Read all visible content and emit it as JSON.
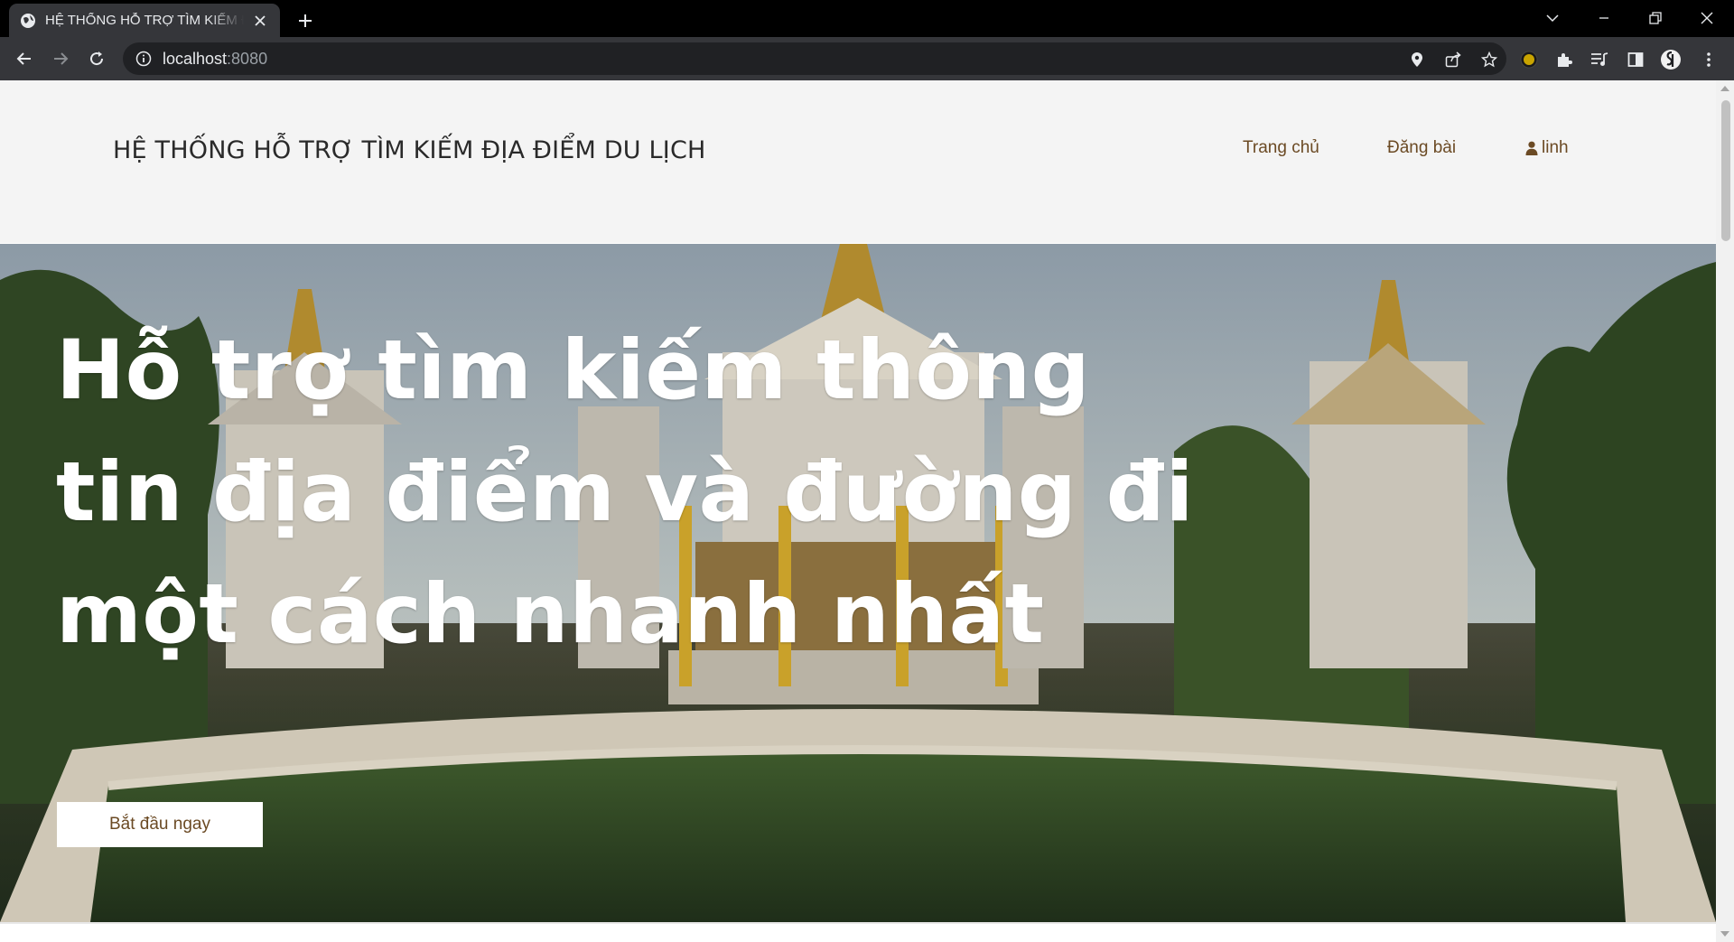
{
  "browser": {
    "tab": {
      "title": "HỆ THỐNG HỖ TRỢ TÌM KIẾM ĐỊA ĐIỂM DU LỊCH",
      "favicon_icon": "globe-icon",
      "close_icon": "close-icon"
    },
    "new_tab_icon": "plus-icon",
    "window_controls": [
      "chevron-down-icon",
      "minimize-icon",
      "restore-icon",
      "close-icon"
    ],
    "nav": {
      "back_icon": "arrow-left-icon",
      "forward_icon": "arrow-right-icon",
      "reload_icon": "reload-icon"
    },
    "address_bar": {
      "host": "localhost",
      "port": ":8080",
      "info_icon": "info-icon"
    },
    "omnibox_icons": [
      "location-pin-icon",
      "share-icon",
      "star-icon"
    ],
    "toolbar_icons": [
      "extension-circle-icon",
      "puzzle-icon",
      "media-control-icon",
      "side-panel-icon",
      "profile-avatar-icon",
      "more-vert-icon"
    ],
    "colors": {
      "tabbar": "#000000",
      "toolbar": "#35363a",
      "omnibox": "#202124"
    }
  },
  "site": {
    "title": "HỆ THỐNG HỖ TRỢ TÌM KIẾM ĐỊA ĐIỂM DU LỊCH",
    "nav": {
      "home": "Trang chủ",
      "post": "Đăng bài",
      "user": "linh",
      "user_icon": "user-icon"
    },
    "hero": {
      "heading": "Hỗ trợ tìm kiếm thông tin địa điểm và đường đi một cách nhanh nhất",
      "cta": "Bắt đầu ngay",
      "background": "pagoda-temple-photo"
    },
    "colors": {
      "header_bg": "#f4f4f4",
      "link": "#6b4a24",
      "hero_text": "#ffffff"
    }
  }
}
